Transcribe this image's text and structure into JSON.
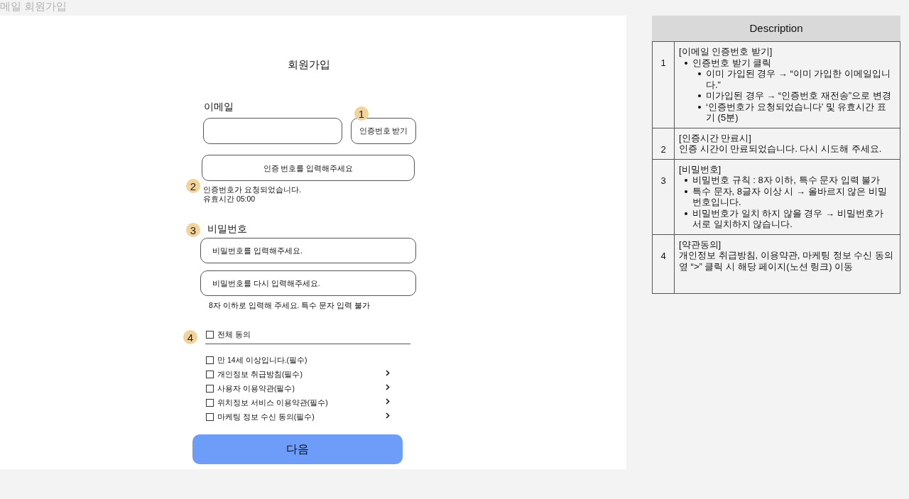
{
  "page_title": "메일 회원가입",
  "form": {
    "title": "회원가입",
    "email": {
      "label": "이메일",
      "button": "인증번호 받기",
      "marker": "1"
    },
    "code": {
      "placeholder": "인증 번호를 입력해주세요",
      "marker": "2",
      "notice": [
        "인증번호가 요청되었습니다.",
        "유효시간 05:00"
      ]
    },
    "password": {
      "marker": "3",
      "label": "비밀번호",
      "fields": [
        {
          "placeholder": "비밀번호를 입력해주세요."
        },
        {
          "placeholder": "비밀번호를 다시 입력해주세요."
        }
      ],
      "hint": "8자 이하로 입력해 주세요. 특수 문자 입력 불가"
    },
    "agreements": {
      "marker": "4",
      "all": {
        "label": "전체 동의",
        "checked": false
      },
      "items": [
        {
          "label": "만 14세 이상입니다.(필수)",
          "checked": false,
          "has_link": false
        },
        {
          "label": "개인정보 취급방침(필수)",
          "checked": false,
          "has_link": true
        },
        {
          "label": "사용자 이용약관(필수)",
          "checked": false,
          "has_link": true
        },
        {
          "label": "위치정보 서비스 이용약관(필수)",
          "checked": false,
          "has_link": true
        },
        {
          "label": "마케팅 정보 수신 동의(필수)",
          "checked": false,
          "has_link": true
        }
      ]
    },
    "next_button": "다음"
  },
  "description": {
    "header": "Description",
    "rows": [
      {
        "number": "1",
        "heading": "[이메일 인증번호 받기]",
        "bullets": [
          {
            "text": "인증번호 받기 클릭",
            "children": [
              {
                "text": "이미 가입된 경우 → “이미 가입한 이메일입니다.”"
              },
              {
                "text": "미가입된 경우 → “인증번호 재전송”으로 변경"
              },
              {
                "text": "‘인증번호가 요청되었습니다’ 및 유효시간 표기 (5분)"
              }
            ]
          }
        ]
      },
      {
        "number": "2",
        "heading": "[인증시간 만료시]",
        "text": "인증 시간이 만료되었습니다. 다시 시도해 주세요."
      },
      {
        "number": "3",
        "heading": "[비밀번호]",
        "bullets": [
          {
            "text": "비밀번호 규칙 : 8자 이하, 특수 문자 입력 불가"
          },
          {
            "text": "특수 문자, 8글자 이상 시 → 올바르지 않은 비밀번호입니다."
          },
          {
            "text": "비밀번호가 일치 하지 않을 경우 → 비밀번호가 서로 일치하지 않습니다."
          }
        ]
      },
      {
        "number": "4",
        "heading": "[약관동의]",
        "text": "개인정보 취급방침, 이용약관, 마케팅 정보 수신 동의 옆 “>” 클릭 시 해당 페이지(노션 링크) 이동"
      }
    ]
  }
}
